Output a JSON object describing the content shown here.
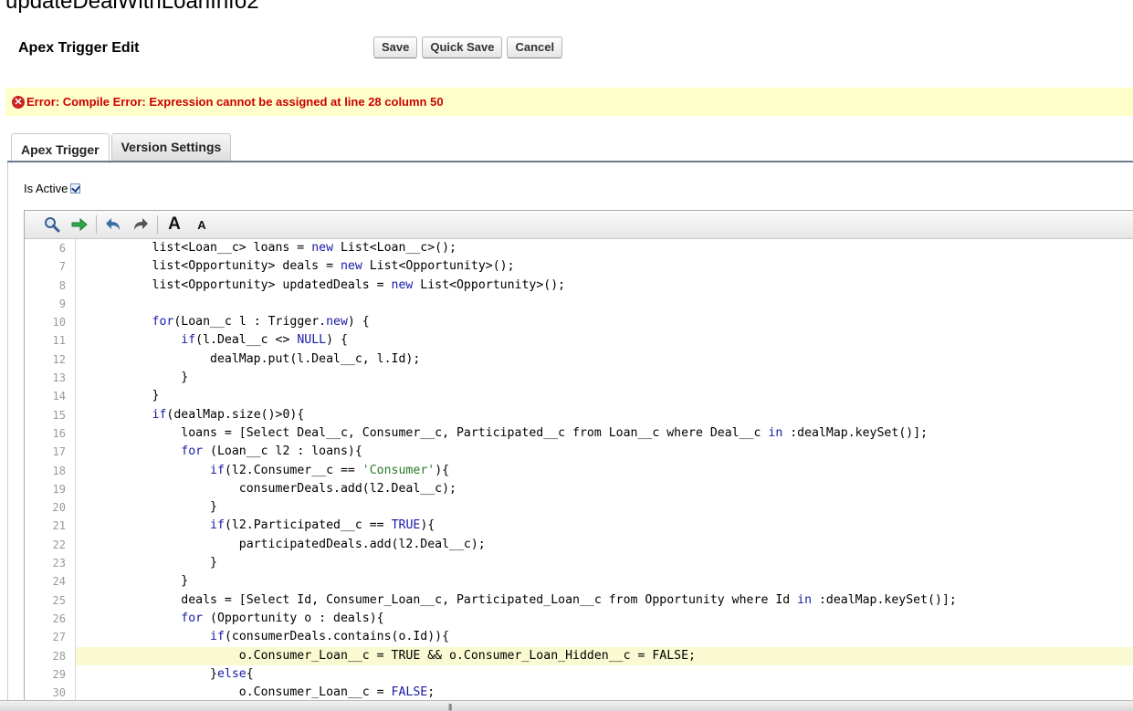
{
  "page": {
    "heading": "updateDealWithLoanInfo2",
    "section_title": "Apex Trigger Edit"
  },
  "buttons": {
    "save": "Save",
    "quick_save": "Quick Save",
    "cancel": "Cancel"
  },
  "error": {
    "message": "Error: Compile Error: Expression cannot be assigned at line 28 column 50",
    "color": "#cc0000"
  },
  "tabs": [
    {
      "label": "Apex Trigger",
      "active": true
    },
    {
      "label": "Version Settings",
      "active": false
    }
  ],
  "is_active": {
    "label": "Is Active",
    "checked": true
  },
  "toolbar": {
    "icons": [
      "search-icon",
      "go-to-line-icon",
      "undo-icon",
      "redo-icon",
      "font-larger-icon",
      "font-smaller-icon"
    ],
    "font_larger_label": "A",
    "font_smaller_label": "A"
  },
  "editor": {
    "highlighted_line": 28,
    "lines": [
      {
        "num": "6",
        "text": "        list<Loan__c> loans = new List<Loan__c>();"
      },
      {
        "num": "7",
        "text": "        list<Opportunity> deals = new List<Opportunity>();"
      },
      {
        "num": "8",
        "text": "        list<Opportunity> updatedDeals = new List<Opportunity>();"
      },
      {
        "num": "9",
        "text": ""
      },
      {
        "num": "10",
        "text": "        for(Loan__c l : Trigger.new) {"
      },
      {
        "num": "11",
        "text": "            if(l.Deal__c <> NULL) {"
      },
      {
        "num": "12",
        "text": "                dealMap.put(l.Deal__c, l.Id);"
      },
      {
        "num": "13",
        "text": "            }"
      },
      {
        "num": "14",
        "text": "        }"
      },
      {
        "num": "15",
        "text": "        if(dealMap.size()>0){"
      },
      {
        "num": "16",
        "text": "            loans = [Select Deal__c, Consumer__c, Participated__c from Loan__c where Deal__c in :dealMap.keySet()];"
      },
      {
        "num": "17",
        "text": "            for (Loan__c l2 : loans){"
      },
      {
        "num": "18",
        "text": "                if(l2.Consumer__c == 'Consumer'){"
      },
      {
        "num": "19",
        "text": "                    consumerDeals.add(l2.Deal__c);"
      },
      {
        "num": "20",
        "text": "                }"
      },
      {
        "num": "21",
        "text": "                if(l2.Participated__c == TRUE){"
      },
      {
        "num": "22",
        "text": "                    participatedDeals.add(l2.Deal__c);"
      },
      {
        "num": "23",
        "text": "                }"
      },
      {
        "num": "24",
        "text": "            }"
      },
      {
        "num": "25",
        "text": "            deals = [Select Id, Consumer_Loan__c, Participated_Loan__c from Opportunity where Id in :dealMap.keySet()];"
      },
      {
        "num": "26",
        "text": "            for (Opportunity o : deals){"
      },
      {
        "num": "27",
        "text": "                if(consumerDeals.contains(o.Id)){"
      },
      {
        "num": "28",
        "text": "                    o.Consumer_Loan__c = TRUE && o.Consumer_Loan_Hidden__c = FALSE;"
      },
      {
        "num": "29",
        "text": "                }else{"
      },
      {
        "num": "30",
        "text": "                    o.Consumer_Loan__c = FALSE;"
      }
    ]
  },
  "colors": {
    "error_bar_bg": "#ffffcc",
    "highlight_line_bg": "#fafad2",
    "keyword": "#1a1aa6",
    "string": "#2a7a2a"
  }
}
